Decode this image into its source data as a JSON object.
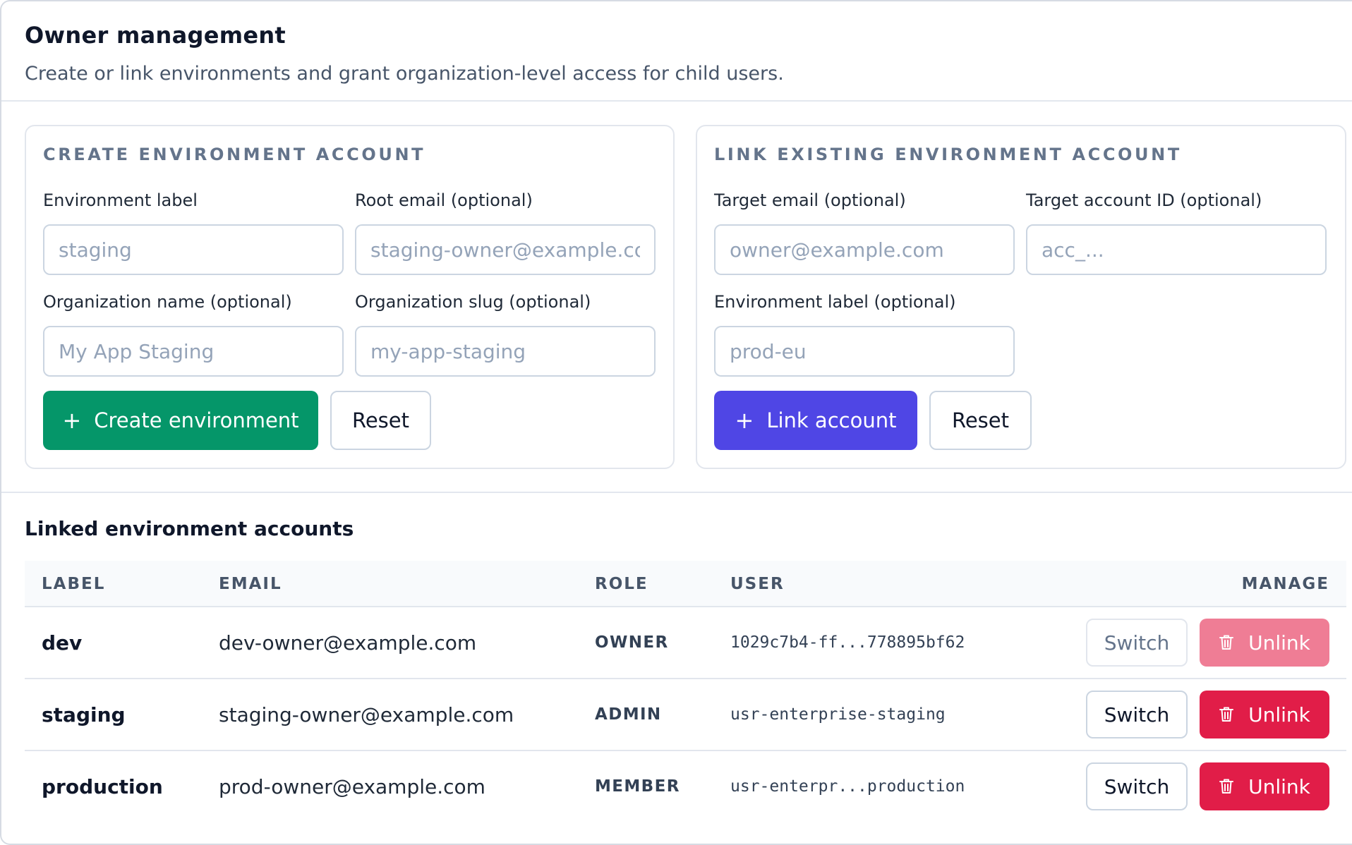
{
  "header": {
    "title": "Owner management",
    "subtitle": "Create or link environments and grant organization-level access for child users."
  },
  "create_card": {
    "title": "CREATE ENVIRONMENT ACCOUNT",
    "env_label": {
      "label": "Environment label",
      "placeholder": "staging",
      "value": ""
    },
    "root_email": {
      "label": "Root email (optional)",
      "placeholder": "staging-owner@example.com",
      "value": ""
    },
    "org_name": {
      "label": "Organization name (optional)",
      "placeholder": "My App Staging",
      "value": ""
    },
    "org_slug": {
      "label": "Organization slug (optional)",
      "placeholder": "my-app-staging",
      "value": ""
    },
    "create_button": "Create environment",
    "create_icon": "plus-icon",
    "reset_button": "Reset"
  },
  "link_card": {
    "title": "LINK EXISTING ENVIRONMENT ACCOUNT",
    "target_email": {
      "label": "Target email (optional)",
      "placeholder": "owner@example.com",
      "value": ""
    },
    "target_account_id": {
      "label": "Target account ID (optional)",
      "placeholder": "acc_...",
      "value": ""
    },
    "env_label": {
      "label": "Environment label (optional)",
      "placeholder": "prod-eu",
      "value": ""
    },
    "link_button": "Link account",
    "link_icon": "plus-icon",
    "reset_button": "Reset"
  },
  "linked_accounts": {
    "title": "Linked environment accounts",
    "columns": {
      "label": "LABEL",
      "email": "EMAIL",
      "role": "ROLE",
      "user": "USER",
      "manage": "MANAGE"
    },
    "switch_label": "Switch",
    "unlink_label": "Unlink",
    "unlink_icon": "trash-icon",
    "rows": [
      {
        "label": "dev",
        "email": "dev-owner@example.com",
        "role": "OWNER",
        "user": "1029c7b4-ff...778895bf62",
        "current": true
      },
      {
        "label": "staging",
        "email": "staging-owner@example.com",
        "role": "ADMIN",
        "user": "usr-enterprise-staging",
        "current": false
      },
      {
        "label": "production",
        "email": "prod-owner@example.com",
        "role": "MEMBER",
        "user": "usr-enterpr...production",
        "current": false
      }
    ]
  },
  "colors": {
    "create_button": "#059669",
    "link_button": "#4f46e5",
    "unlink_button": "#e11d48",
    "unlink_button_disabled": "#ef7d95"
  }
}
